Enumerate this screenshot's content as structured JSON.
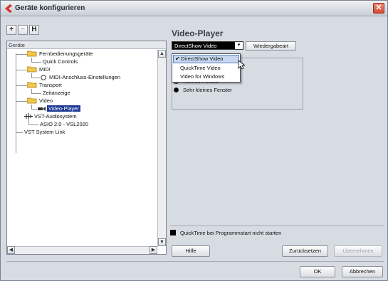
{
  "window": {
    "title": "Geräte konfigurieren"
  },
  "toolbar": {
    "add": "+",
    "remove": "−",
    "reset": "H"
  },
  "tree": {
    "header": "Geräte",
    "nodes": [
      {
        "label": "Fernbedienungsgeräte",
        "type": "folder",
        "level": 1
      },
      {
        "label": "Quick Controls",
        "type": "leaf",
        "level": 2
      },
      {
        "label": "MIDI",
        "type": "folder",
        "level": 1
      },
      {
        "label": "MIDI-Anschluss-Einstellungen",
        "type": "midi",
        "level": 2
      },
      {
        "label": "Transport",
        "type": "folder",
        "level": 1
      },
      {
        "label": "Zeitanzeige",
        "type": "leaf",
        "level": 2
      },
      {
        "label": "Video",
        "type": "folder",
        "level": 1
      },
      {
        "label": "Video-Player",
        "type": "selected",
        "level": 2
      },
      {
        "label": "VST-Audiosystem",
        "type": "audio",
        "level": 1
      },
      {
        "label": "ASIO 2.0 - VSL2020",
        "type": "leaf",
        "level": 2
      },
      {
        "label": "VST System Link",
        "type": "leaf",
        "level": 1
      }
    ]
  },
  "panel": {
    "title": "Video-Player",
    "select_value": "DirectShow Video",
    "playback_button": "Wiedergabeart",
    "menu_items": [
      "DirectShow Video",
      "QuickTime Video",
      "Video for Windows"
    ],
    "radios": [
      "Kleines Fenster",
      "Sehr kleines Fenster"
    ],
    "checkbox_label": "QuickTime bei Programmstart nicht starten"
  },
  "buttons": {
    "help": "Hilfe",
    "reset": "Zurücksetzen",
    "apply": "Übernehmen",
    "ok": "OK",
    "cancel": "Abbrechen"
  },
  "colors": {
    "selection": "#1f3a93",
    "close": "#d24b33"
  }
}
